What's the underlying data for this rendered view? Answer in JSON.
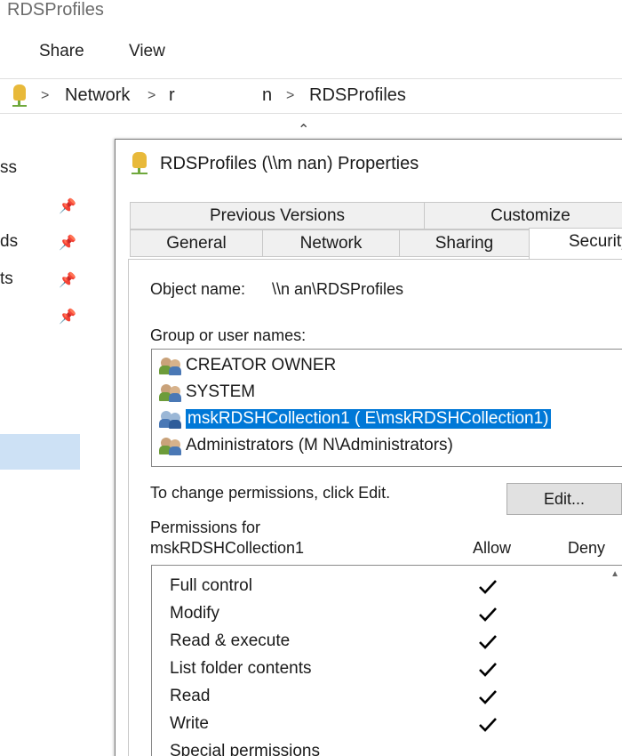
{
  "window": {
    "title": "RDSProfiles"
  },
  "ribbon": {
    "tabs": [
      "Share",
      "View"
    ]
  },
  "address": {
    "parts": [
      "Network",
      "r",
      "n",
      "RDSProfiles"
    ]
  },
  "nav": {
    "items": [
      "ss",
      "ds",
      "ts"
    ]
  },
  "dialog": {
    "title": "RDSProfiles (\\\\m          nan) Properties",
    "tabs_row1": [
      "Previous Versions",
      "Customize"
    ],
    "tabs_row2": [
      "General",
      "Network",
      "Sharing",
      "Security"
    ],
    "active_tab": "Security",
    "object_label": "Object name:",
    "object_value": "\\\\n              an\\RDSProfiles",
    "groups_label": "Group or user names:",
    "groups": [
      {
        "name": "CREATOR OWNER",
        "selected": false
      },
      {
        "name": "SYSTEM",
        "selected": false
      },
      {
        "name": "mskRDSHCollection1 (               E\\mskRDSHCollection1)",
        "selected": true
      },
      {
        "name": "Administrators (M                    N\\Administrators)",
        "selected": false
      }
    ],
    "change_text": "To change permissions, click Edit.",
    "edit_label": "Edit...",
    "perm_for_line1": "Permissions for",
    "perm_for_line2": "mskRDSHCollection1",
    "allow_label": "Allow",
    "deny_label": "Deny",
    "permissions": [
      {
        "name": "Full control",
        "allow": true,
        "deny": false
      },
      {
        "name": "Modify",
        "allow": true,
        "deny": false
      },
      {
        "name": "Read & execute",
        "allow": true,
        "deny": false
      },
      {
        "name": "List folder contents",
        "allow": true,
        "deny": false
      },
      {
        "name": "Read",
        "allow": true,
        "deny": false
      },
      {
        "name": "Write",
        "allow": true,
        "deny": false
      },
      {
        "name": "Special permissions",
        "allow": false,
        "deny": false
      }
    ]
  },
  "colors": {
    "selection": "#0078d7",
    "nav_selection": "#cde1f5",
    "folder": "#e8b93a",
    "share_pipe": "#6fa83c"
  }
}
